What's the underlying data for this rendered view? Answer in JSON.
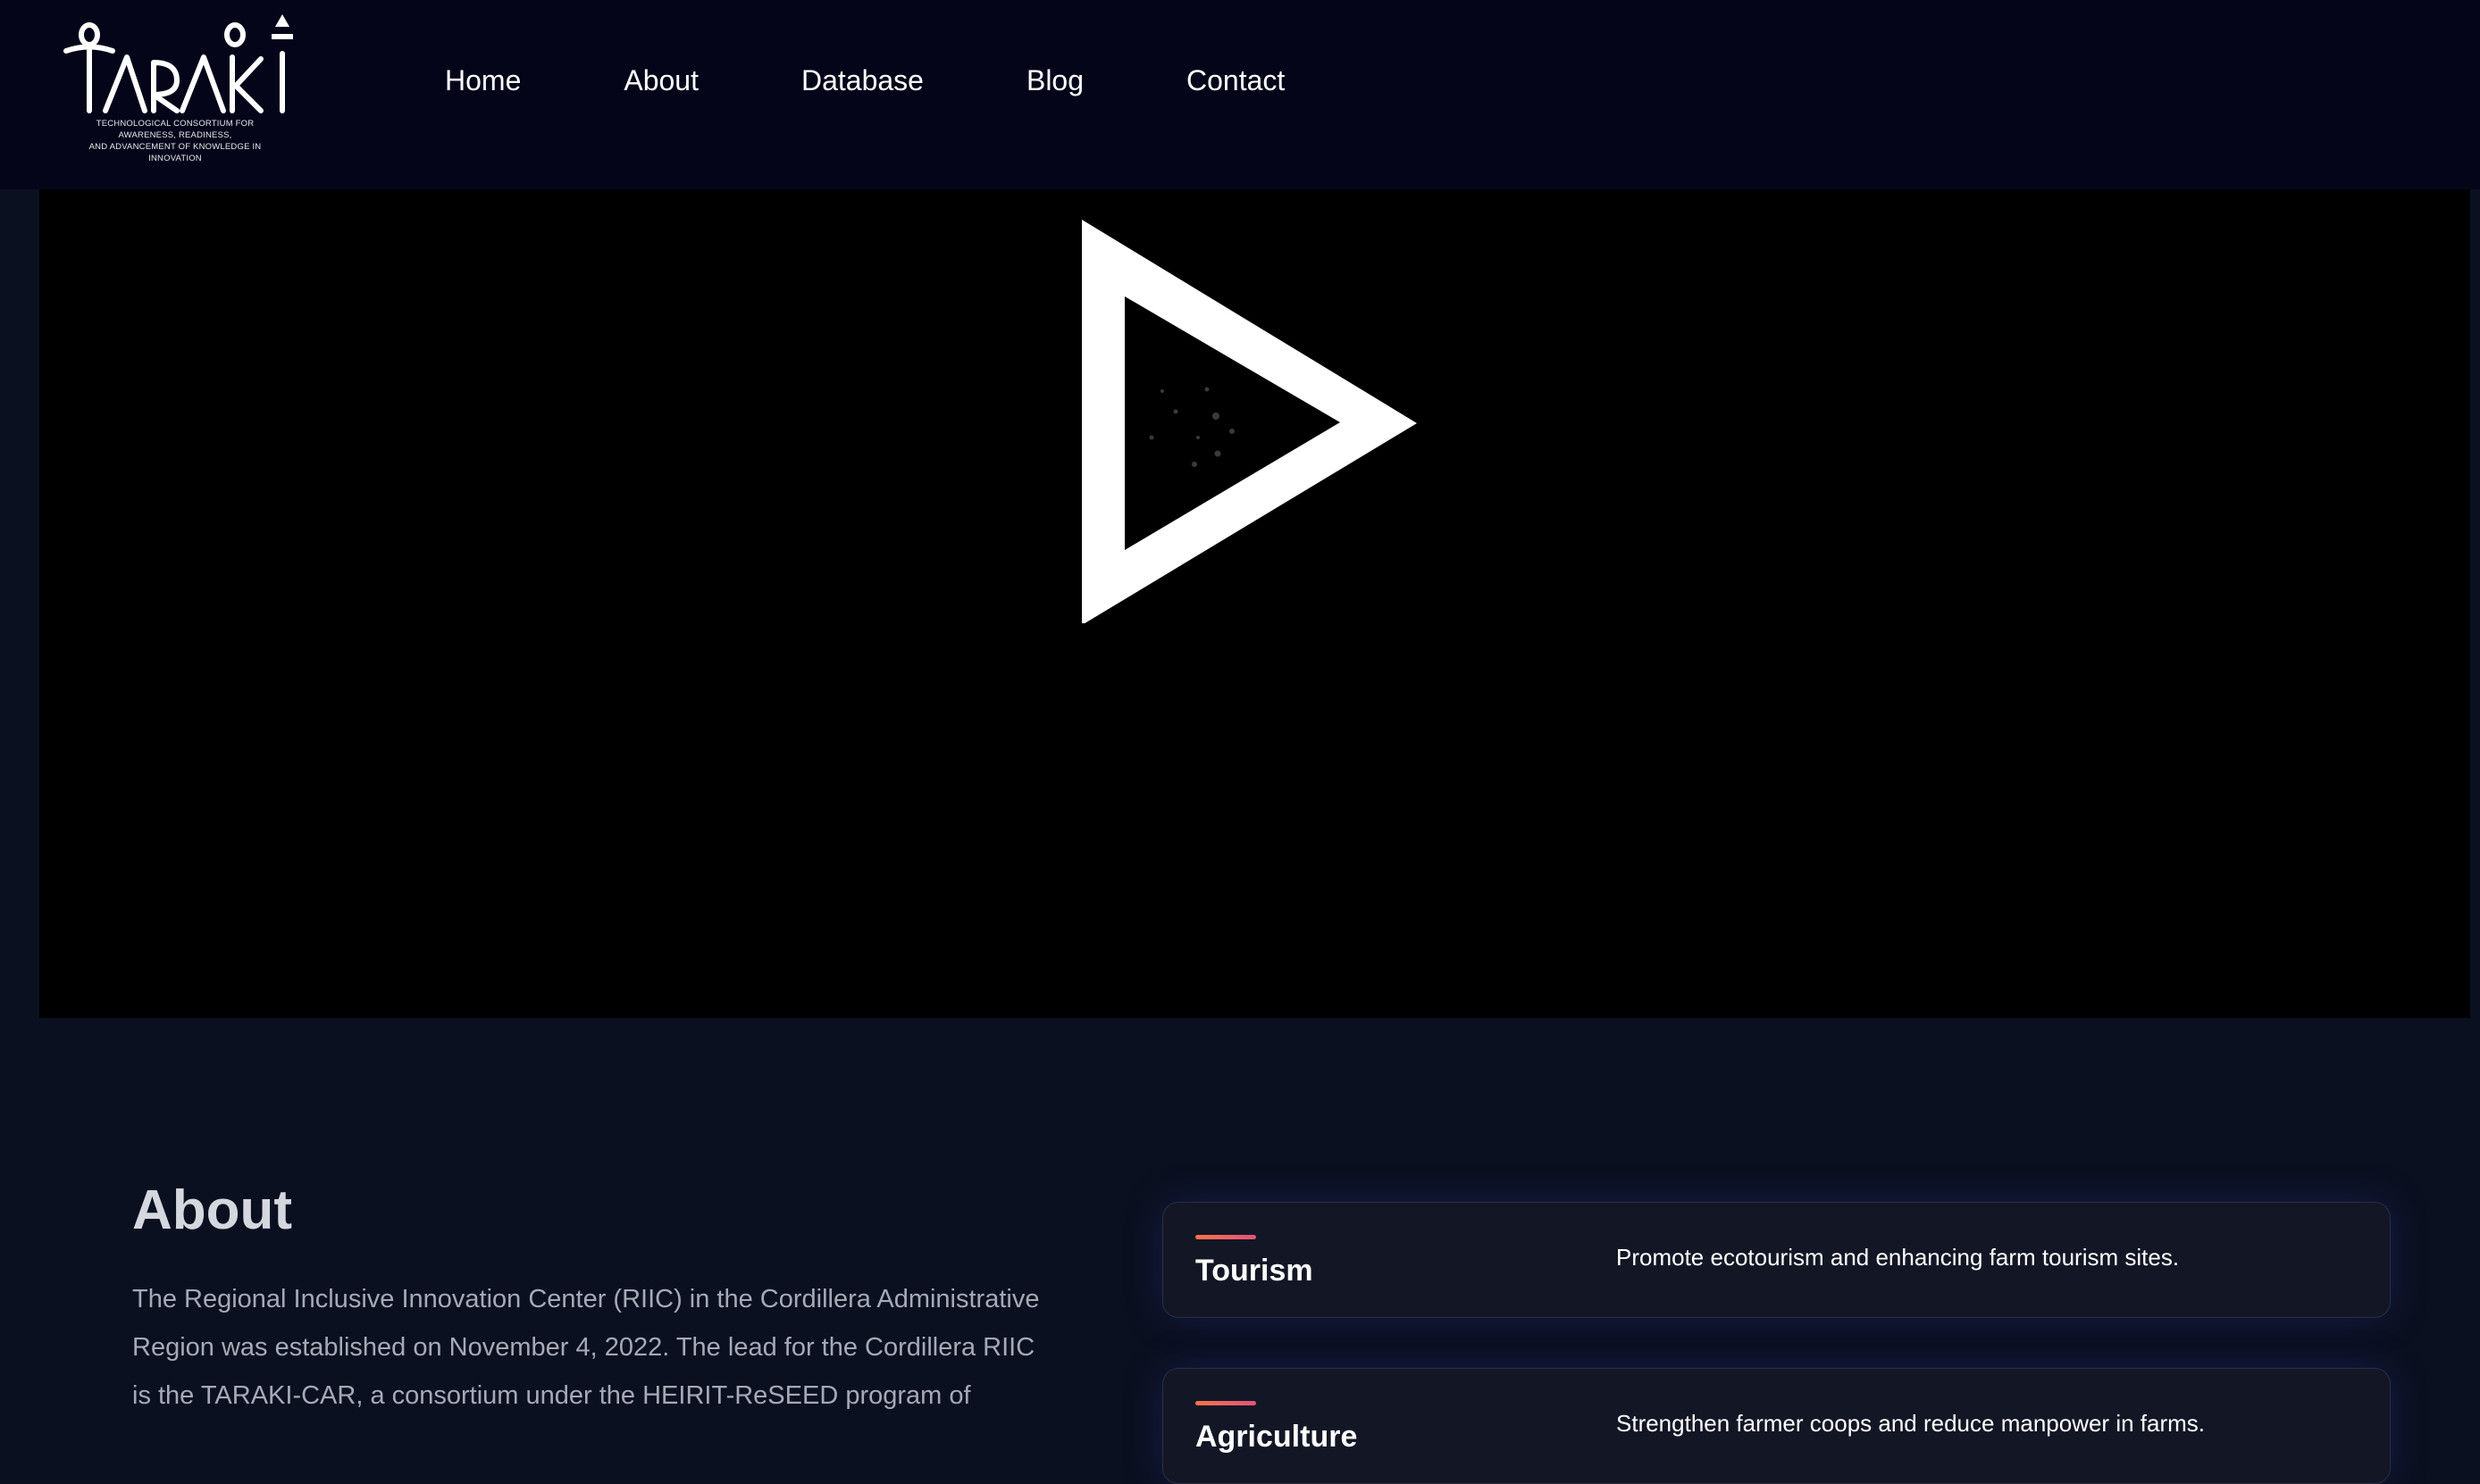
{
  "brand": {
    "logo_text": "TARAKI",
    "tagline_line1": "TECHNOLOGICAL CONSORTIUM FOR AWARENESS, READINESS,",
    "tagline_line2": "AND ADVANCEMENT OF KNOWLEDGE IN INNOVATION"
  },
  "nav": {
    "items": [
      {
        "label": "Home"
      },
      {
        "label": "About"
      },
      {
        "label": "Database"
      },
      {
        "label": "Blog"
      },
      {
        "label": "Contact"
      }
    ]
  },
  "video": {
    "play_icon": "play-triangle-icon"
  },
  "about": {
    "title": "About",
    "text": "The Regional Inclusive Innovation Center (RIIC) in the Cordillera Administrative Region was established on November 4, 2022. The lead for the Cordillera RIIC is the TARAKI-CAR, a consortium under the HEIRIT-ReSEED program of"
  },
  "cards": [
    {
      "title": "Tourism",
      "description": "Promote ecotourism and enhancing farm tourism sites."
    },
    {
      "title": "Agriculture",
      "description": "Strengthen farmer coops and reduce manpower in farms."
    }
  ],
  "colors": {
    "header_bg": "#05051a",
    "page_bg": "#0b1020",
    "card_bg": "#131725",
    "accent_start": "#f7734a",
    "accent_end": "#e2547a"
  }
}
